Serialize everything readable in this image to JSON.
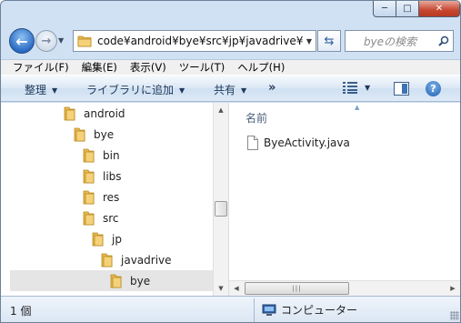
{
  "navigation": {
    "address_path": "code¥android¥bye¥src¥jp¥javadrive¥bye",
    "search_placeholder": "byeの検索"
  },
  "menubar": {
    "items": [
      "ファイル(F)",
      "編集(E)",
      "表示(V)",
      "ツール(T)",
      "ヘルプ(H)"
    ]
  },
  "command_bar": {
    "organize": "整理",
    "add_to_library": "ライブラリに追加",
    "share": "共有",
    "more": "»"
  },
  "tree": {
    "items": [
      {
        "label": "android"
      },
      {
        "label": "bye"
      },
      {
        "label": "bin"
      },
      {
        "label": "libs"
      },
      {
        "label": "res"
      },
      {
        "label": "src"
      },
      {
        "label": "jp"
      },
      {
        "label": "javadrive"
      },
      {
        "label": "bye",
        "selected": true
      }
    ]
  },
  "content": {
    "column_name": "名前",
    "files": [
      {
        "name": "ByeActivity.java"
      }
    ]
  },
  "status": {
    "item_count": "1 個",
    "location": "コンピューター"
  },
  "colors": {
    "folder": "#e8b84a",
    "accent": "#2a6cc4",
    "command_text": "#1e395b",
    "selection": "#e5e5e5"
  },
  "icons": {
    "back": "arrow-left-icon",
    "forward": "arrow-right-icon",
    "refresh": "refresh-icon",
    "search": "search-icon",
    "help": "help-icon",
    "folder": "folder-icon",
    "file": "document-icon",
    "computer": "computer-icon"
  }
}
